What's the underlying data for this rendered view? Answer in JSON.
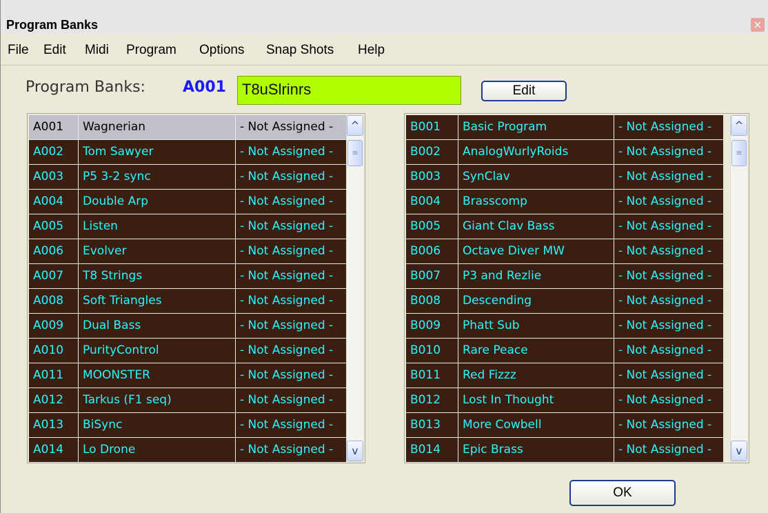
{
  "window": {
    "title": "Program Banks",
    "close_glyph": "×"
  },
  "menu": [
    "File",
    "Edit",
    "Midi",
    "Program",
    "Options",
    "Snap Shots",
    "Help"
  ],
  "bank": {
    "label": "Program Banks:",
    "code": "A001",
    "name": "T8uSlrinrs"
  },
  "buttons": {
    "edit": "Edit",
    "ok": "OK"
  },
  "bank_a": [
    [
      "A001",
      "Wagnerian",
      "- Not Assigned -"
    ],
    [
      "A002",
      "Tom Sawyer",
      "- Not Assigned -"
    ],
    [
      "A003",
      "P5 3-2 sync",
      "- Not Assigned -"
    ],
    [
      "A004",
      "Double Arp",
      "- Not Assigned -"
    ],
    [
      "A005",
      "Listen",
      "- Not Assigned -"
    ],
    [
      "A006",
      "Evolver",
      "- Not Assigned -"
    ],
    [
      "A007",
      "T8 Strings",
      "- Not Assigned -"
    ],
    [
      "A008",
      "Soft Triangles",
      "- Not Assigned -"
    ],
    [
      "A009",
      "Dual Bass",
      "- Not Assigned -"
    ],
    [
      "A010",
      "PurityControl",
      "- Not Assigned -"
    ],
    [
      "A011",
      "MOONSTER",
      "- Not Assigned -"
    ],
    [
      "A012",
      "Tarkus  (F1 seq)",
      "- Not Assigned -"
    ],
    [
      "A013",
      "BiSync",
      "- Not Assigned -"
    ],
    [
      "A014",
      "Lo Drone",
      "- Not Assigned -"
    ]
  ],
  "bank_b": [
    [
      "B001",
      "Basic Program",
      "- Not Assigned -"
    ],
    [
      "B002",
      "AnalogWurlyRoids",
      "- Not Assigned -"
    ],
    [
      "B003",
      "SynClav",
      "- Not Assigned -"
    ],
    [
      "B004",
      "Brasscomp",
      "- Not Assigned -"
    ],
    [
      "B005",
      "Giant Clav Bass",
      "- Not Assigned -"
    ],
    [
      "B006",
      "Octave Diver MW",
      "- Not Assigned -"
    ],
    [
      "B007",
      "P3 and Rezlie",
      "- Not Assigned -"
    ],
    [
      "B008",
      "Descending",
      "- Not Assigned -"
    ],
    [
      "B009",
      "Phatt Sub",
      "- Not Assigned -"
    ],
    [
      "B010",
      "Rare Peace",
      "- Not Assigned -"
    ],
    [
      "B011",
      "Red Fizzz",
      "- Not Assigned -"
    ],
    [
      "B012",
      "Lost In Thought",
      "- Not Assigned -"
    ],
    [
      "B013",
      "More Cowbell",
      "- Not Assigned -"
    ],
    [
      "B014",
      "Epic Brass",
      "- Not Assigned -"
    ]
  ],
  "selected_row": "A001",
  "colors": {
    "row_bg": "#3a1f10",
    "row_text": "#2cf5ff",
    "name_field_bg": "#b0ff00",
    "bank_code": "#1a1aff"
  },
  "icons": {
    "scroll_up": "^",
    "scroll_down": "v"
  }
}
